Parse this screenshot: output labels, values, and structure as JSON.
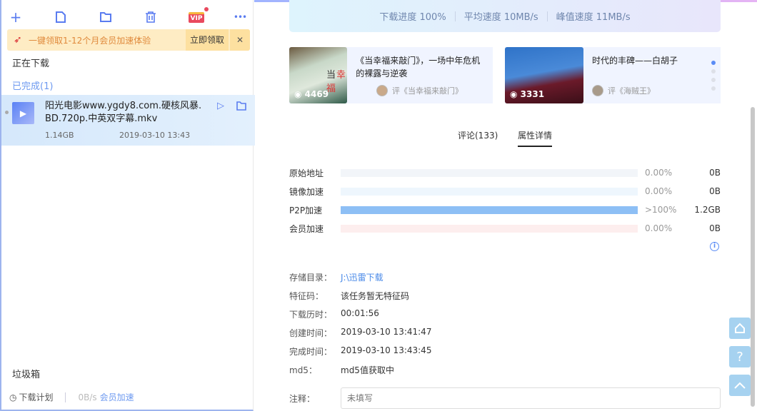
{
  "toolbar": {
    "new": "+",
    "vip": "VIP",
    "more": "•••"
  },
  "banner": {
    "text": "一键领取1-12个月会员加速体验",
    "claim": "立即领取",
    "close": "✕"
  },
  "sections": {
    "downloading": "正在下载",
    "completed": "已完成(1)",
    "trash": "垃圾箱"
  },
  "task": {
    "name": "阳光电影www.ygdy8.com.硬核风暴.BD.720p.中英双字幕.mkv",
    "size": "1.14GB",
    "time": "2019-03-10 13:43"
  },
  "footer": {
    "schedule": "下载计划",
    "speed": "0B/s",
    "vip": "会员加速"
  },
  "stats": {
    "progress": "下载进度 100%",
    "avg": "平均速度 10MB/s",
    "peak": "峰值速度 11MB/s"
  },
  "cards": [
    {
      "views": "4469",
      "poster_text": "当幸福来敲",
      "title": "《当幸福来敲门》，一场中年危机的裸露与逆袭",
      "tag": "评《当幸福来敲门》"
    },
    {
      "views": "3331",
      "title": "时代的丰碑——白胡子",
      "tag": "评《海贼王》"
    }
  ],
  "tabs": {
    "comments": "评论(133)",
    "details": "属性详情"
  },
  "sources": [
    {
      "label": "原始地址",
      "percent": "0.00%",
      "size": "0B",
      "fill": 0,
      "color": "#f2f5f9"
    },
    {
      "label": "镜像加速",
      "percent": "0.00%",
      "size": "0B",
      "fill": 0,
      "color": "#eef6fd"
    },
    {
      "label": "P2P加速",
      "percent": ">100%",
      "size": "1.2GB",
      "fill": 1,
      "color": "#8dbff5"
    },
    {
      "label": "会员加速",
      "percent": "0.00%",
      "size": "0B",
      "fill": 0,
      "color": "#fdeeee"
    }
  ],
  "fields": [
    {
      "label": "存储目录：",
      "value": "J:\\迅雷下载"
    },
    {
      "label": "特征码：",
      "value": "该任务暂无特征码"
    },
    {
      "label": "下载历时：",
      "value": "00:01:56"
    },
    {
      "label": "创建时间：",
      "value": "2019-03-10 13:41:47"
    },
    {
      "label": "完成时间：",
      "value": "2019-03-10 13:43:45"
    },
    {
      "label": "md5：",
      "value": "md5值获取中"
    }
  ],
  "note": {
    "label": "注释：",
    "placeholder": "未填写"
  },
  "float": {
    "help": "?"
  }
}
